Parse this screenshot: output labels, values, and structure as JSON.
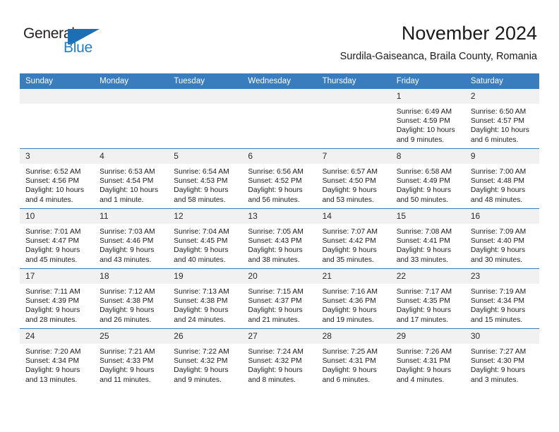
{
  "logo": {
    "text_top": "General",
    "text_bottom": "Blue",
    "mark": "blue-flag-triangle",
    "brand_color": "#1c6fb5"
  },
  "header": {
    "title": "November 2024",
    "subtitle": "Surdila-Gaiseanca, Braila County, Romania"
  },
  "theme": {
    "header_row_bg": "#3a7dbf",
    "header_row_text": "#ffffff",
    "daynum_bg": "#f1f1f1",
    "row_border": "#3a7dbf",
    "text": "#1a1a1a"
  },
  "calendar": {
    "weekday_headers": [
      "Sunday",
      "Monday",
      "Tuesday",
      "Wednesday",
      "Thursday",
      "Friday",
      "Saturday"
    ],
    "weeks": [
      [
        {
          "day": "",
          "sunrise": "",
          "sunset": "",
          "daylight": ""
        },
        {
          "day": "",
          "sunrise": "",
          "sunset": "",
          "daylight": ""
        },
        {
          "day": "",
          "sunrise": "",
          "sunset": "",
          "daylight": ""
        },
        {
          "day": "",
          "sunrise": "",
          "sunset": "",
          "daylight": ""
        },
        {
          "day": "",
          "sunrise": "",
          "sunset": "",
          "daylight": ""
        },
        {
          "day": "1",
          "sunrise": "Sunrise: 6:49 AM",
          "sunset": "Sunset: 4:59 PM",
          "daylight": "Daylight: 10 hours and 9 minutes."
        },
        {
          "day": "2",
          "sunrise": "Sunrise: 6:50 AM",
          "sunset": "Sunset: 4:57 PM",
          "daylight": "Daylight: 10 hours and 6 minutes."
        }
      ],
      [
        {
          "day": "3",
          "sunrise": "Sunrise: 6:52 AM",
          "sunset": "Sunset: 4:56 PM",
          "daylight": "Daylight: 10 hours and 4 minutes."
        },
        {
          "day": "4",
          "sunrise": "Sunrise: 6:53 AM",
          "sunset": "Sunset: 4:54 PM",
          "daylight": "Daylight: 10 hours and 1 minute."
        },
        {
          "day": "5",
          "sunrise": "Sunrise: 6:54 AM",
          "sunset": "Sunset: 4:53 PM",
          "daylight": "Daylight: 9 hours and 58 minutes."
        },
        {
          "day": "6",
          "sunrise": "Sunrise: 6:56 AM",
          "sunset": "Sunset: 4:52 PM",
          "daylight": "Daylight: 9 hours and 56 minutes."
        },
        {
          "day": "7",
          "sunrise": "Sunrise: 6:57 AM",
          "sunset": "Sunset: 4:50 PM",
          "daylight": "Daylight: 9 hours and 53 minutes."
        },
        {
          "day": "8",
          "sunrise": "Sunrise: 6:58 AM",
          "sunset": "Sunset: 4:49 PM",
          "daylight": "Daylight: 9 hours and 50 minutes."
        },
        {
          "day": "9",
          "sunrise": "Sunrise: 7:00 AM",
          "sunset": "Sunset: 4:48 PM",
          "daylight": "Daylight: 9 hours and 48 minutes."
        }
      ],
      [
        {
          "day": "10",
          "sunrise": "Sunrise: 7:01 AM",
          "sunset": "Sunset: 4:47 PM",
          "daylight": "Daylight: 9 hours and 45 minutes."
        },
        {
          "day": "11",
          "sunrise": "Sunrise: 7:03 AM",
          "sunset": "Sunset: 4:46 PM",
          "daylight": "Daylight: 9 hours and 43 minutes."
        },
        {
          "day": "12",
          "sunrise": "Sunrise: 7:04 AM",
          "sunset": "Sunset: 4:45 PM",
          "daylight": "Daylight: 9 hours and 40 minutes."
        },
        {
          "day": "13",
          "sunrise": "Sunrise: 7:05 AM",
          "sunset": "Sunset: 4:43 PM",
          "daylight": "Daylight: 9 hours and 38 minutes."
        },
        {
          "day": "14",
          "sunrise": "Sunrise: 7:07 AM",
          "sunset": "Sunset: 4:42 PM",
          "daylight": "Daylight: 9 hours and 35 minutes."
        },
        {
          "day": "15",
          "sunrise": "Sunrise: 7:08 AM",
          "sunset": "Sunset: 4:41 PM",
          "daylight": "Daylight: 9 hours and 33 minutes."
        },
        {
          "day": "16",
          "sunrise": "Sunrise: 7:09 AM",
          "sunset": "Sunset: 4:40 PM",
          "daylight": "Daylight: 9 hours and 30 minutes."
        }
      ],
      [
        {
          "day": "17",
          "sunrise": "Sunrise: 7:11 AM",
          "sunset": "Sunset: 4:39 PM",
          "daylight": "Daylight: 9 hours and 28 minutes."
        },
        {
          "day": "18",
          "sunrise": "Sunrise: 7:12 AM",
          "sunset": "Sunset: 4:38 PM",
          "daylight": "Daylight: 9 hours and 26 minutes."
        },
        {
          "day": "19",
          "sunrise": "Sunrise: 7:13 AM",
          "sunset": "Sunset: 4:38 PM",
          "daylight": "Daylight: 9 hours and 24 minutes."
        },
        {
          "day": "20",
          "sunrise": "Sunrise: 7:15 AM",
          "sunset": "Sunset: 4:37 PM",
          "daylight": "Daylight: 9 hours and 21 minutes."
        },
        {
          "day": "21",
          "sunrise": "Sunrise: 7:16 AM",
          "sunset": "Sunset: 4:36 PM",
          "daylight": "Daylight: 9 hours and 19 minutes."
        },
        {
          "day": "22",
          "sunrise": "Sunrise: 7:17 AM",
          "sunset": "Sunset: 4:35 PM",
          "daylight": "Daylight: 9 hours and 17 minutes."
        },
        {
          "day": "23",
          "sunrise": "Sunrise: 7:19 AM",
          "sunset": "Sunset: 4:34 PM",
          "daylight": "Daylight: 9 hours and 15 minutes."
        }
      ],
      [
        {
          "day": "24",
          "sunrise": "Sunrise: 7:20 AM",
          "sunset": "Sunset: 4:34 PM",
          "daylight": "Daylight: 9 hours and 13 minutes."
        },
        {
          "day": "25",
          "sunrise": "Sunrise: 7:21 AM",
          "sunset": "Sunset: 4:33 PM",
          "daylight": "Daylight: 9 hours and 11 minutes."
        },
        {
          "day": "26",
          "sunrise": "Sunrise: 7:22 AM",
          "sunset": "Sunset: 4:32 PM",
          "daylight": "Daylight: 9 hours and 9 minutes."
        },
        {
          "day": "27",
          "sunrise": "Sunrise: 7:24 AM",
          "sunset": "Sunset: 4:32 PM",
          "daylight": "Daylight: 9 hours and 8 minutes."
        },
        {
          "day": "28",
          "sunrise": "Sunrise: 7:25 AM",
          "sunset": "Sunset: 4:31 PM",
          "daylight": "Daylight: 9 hours and 6 minutes."
        },
        {
          "day": "29",
          "sunrise": "Sunrise: 7:26 AM",
          "sunset": "Sunset: 4:31 PM",
          "daylight": "Daylight: 9 hours and 4 minutes."
        },
        {
          "day": "30",
          "sunrise": "Sunrise: 7:27 AM",
          "sunset": "Sunset: 4:30 PM",
          "daylight": "Daylight: 9 hours and 3 minutes."
        }
      ]
    ]
  }
}
